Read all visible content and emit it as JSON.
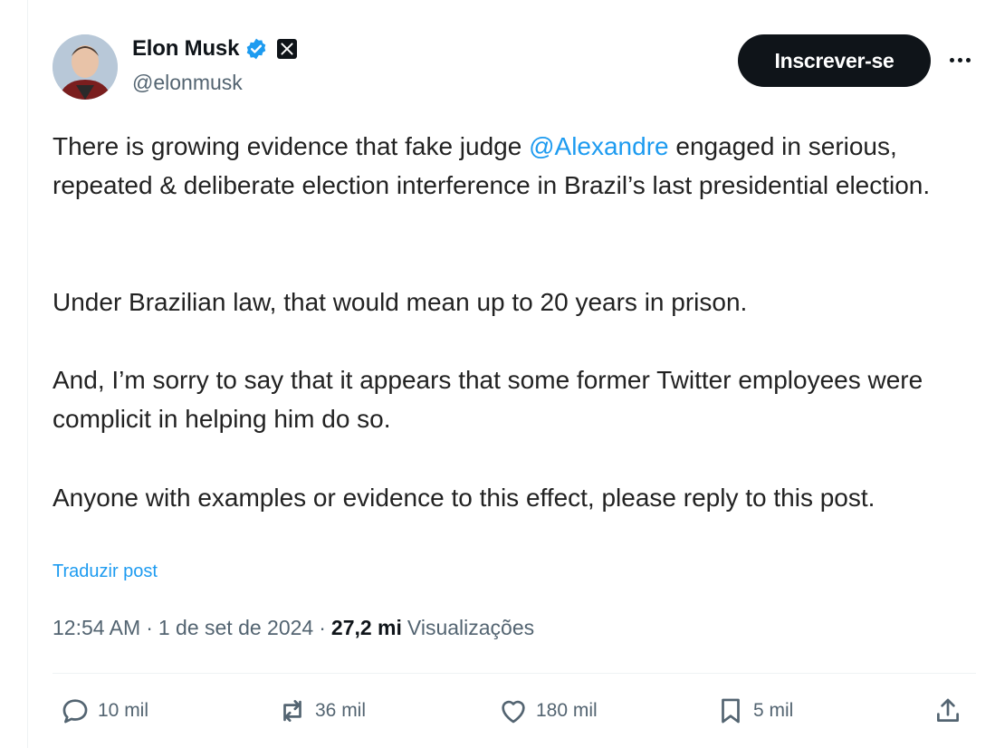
{
  "author": {
    "name": "Elon Musk",
    "handle": "@elonmusk"
  },
  "follow_label": "Inscrever-se",
  "post": {
    "para1_prefix": "There is growing evidence that fake judge ",
    "mention": "@Alexandre",
    "para1_suffix": " engaged in serious, repeated & deliberate election interference in Brazil’s last presidential election.",
    "para2": "Under Brazilian law, that would mean up to 20 years in prison.",
    "para3": "And, I’m sorry to say that it appears that some former Twitter employees were complicit in helping him do so.",
    "para4": "Anyone with examples or evidence to this effect, please reply to this post."
  },
  "translate_label": "Traduzir post",
  "meta": {
    "time": "12:54 AM",
    "sep1": "·",
    "date": "1 de set de 2024",
    "sep2": "·",
    "views_count": "27,2 mi",
    "views_label": "Visualizações"
  },
  "actions": {
    "replies": "10 mil",
    "reposts": "36 mil",
    "likes": "180 mil",
    "bookmarks": "5 mil"
  },
  "colors": {
    "accent": "#1d9bf0",
    "text": "#0f1419",
    "muted": "#536471"
  }
}
